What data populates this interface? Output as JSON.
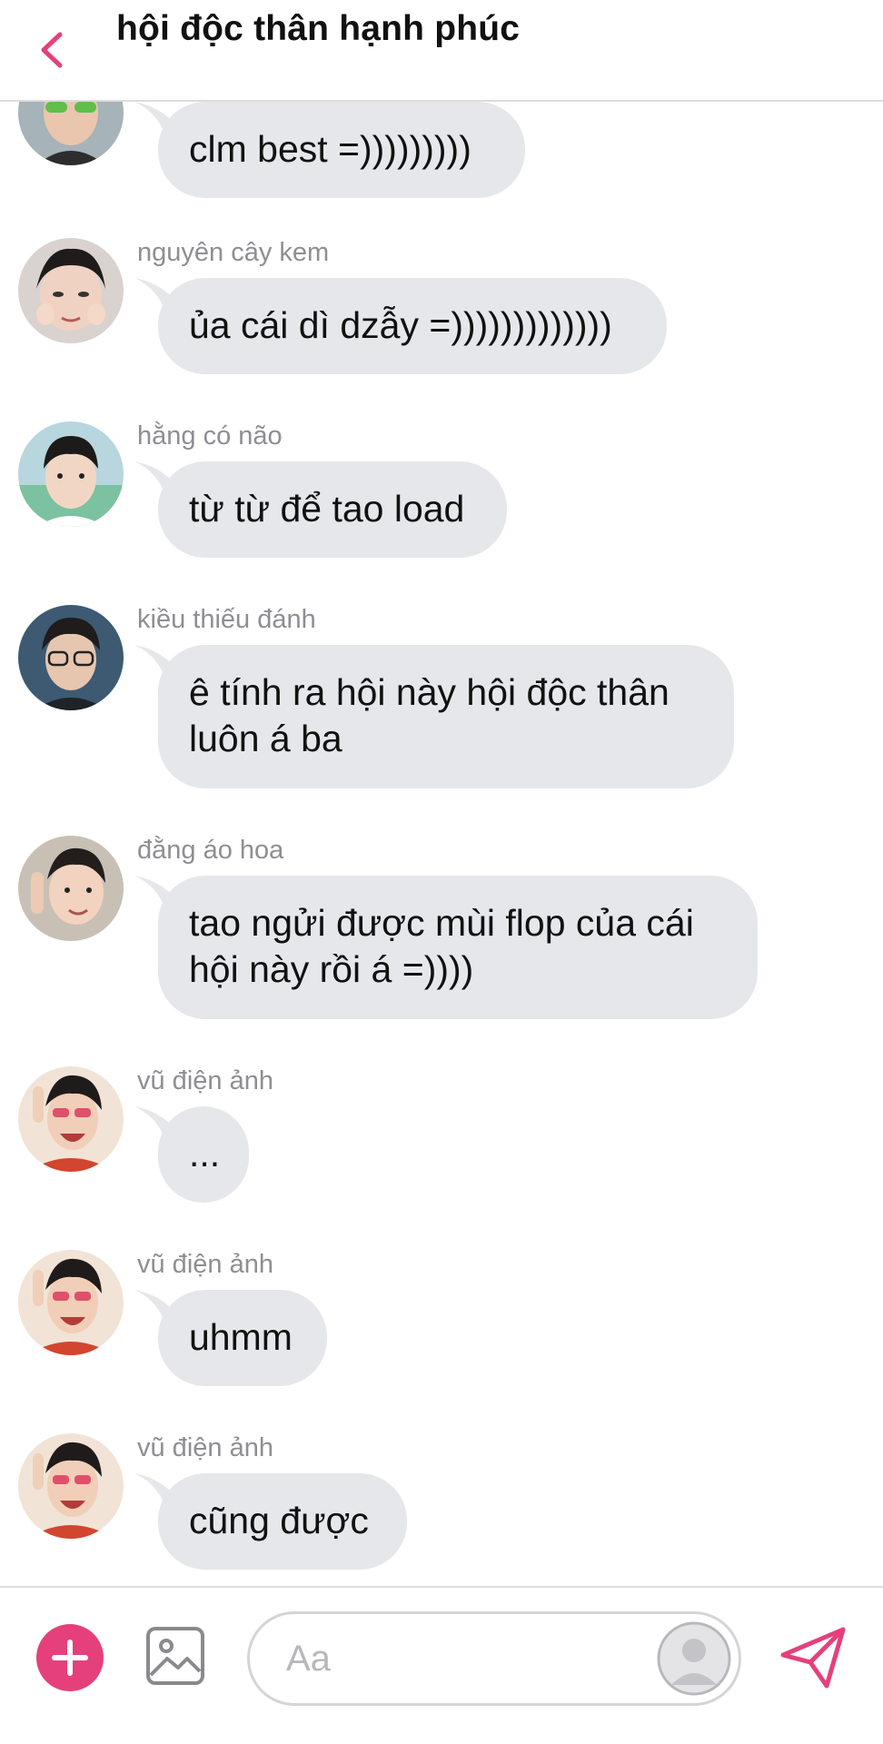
{
  "header": {
    "title": "hội độc thân hạnh phúc",
    "back_icon": "chevron-left-icon",
    "accent_color": "#e5407c"
  },
  "messages": [
    {
      "sender": "",
      "text": "clm best =)))))))))"
    },
    {
      "sender": "nguyên cây kem",
      "text": "ủa cái dì dzẫy =)))))))))))))"
    },
    {
      "sender": "hằng có não",
      "text": "từ từ để tao load"
    },
    {
      "sender": "kiều thiếu đánh",
      "text": "ê tính ra hội này hội độc thân luôn á ba"
    },
    {
      "sender": "đằng áo hoa",
      "text": "tao ngửi được mùi flop của cái hội này rồi á =))))"
    },
    {
      "sender": "vũ điện ảnh",
      "text": "..."
    },
    {
      "sender": "vũ điện ảnh",
      "text": "uhmm"
    },
    {
      "sender": "vũ điện ảnh",
      "text": "cũng được"
    }
  ],
  "composer": {
    "placeholder": "Aa",
    "plus_icon": "plus-icon",
    "image_icon": "image-icon",
    "send_icon": "send-icon",
    "profile_icon": "profile-icon"
  },
  "colors": {
    "bubble": "#e6e7ea",
    "sender_name": "#8e8e93",
    "accent": "#e5407c"
  }
}
